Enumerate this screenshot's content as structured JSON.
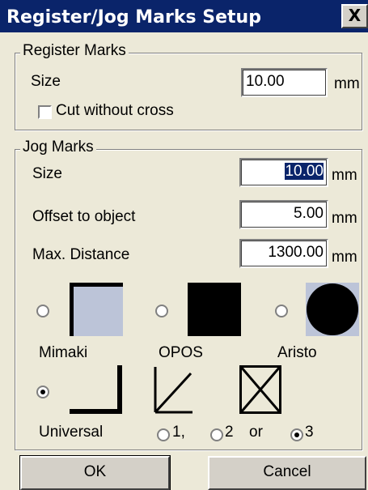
{
  "window": {
    "title": "Register/Jog Marks Setup",
    "close_label": "X"
  },
  "register_marks": {
    "legend": "Register Marks",
    "size_label": "Size",
    "size_value": "10.00",
    "size_unit": "mm",
    "cut_without_cross_label": "Cut without cross",
    "cut_without_cross_checked": false
  },
  "jog_marks": {
    "legend": "Jog  Marks",
    "size_label": "Size",
    "size_value": "10.00",
    "size_unit": "mm",
    "offset_label": "Offset to object",
    "offset_value": "5.00",
    "offset_unit": "mm",
    "max_distance_label": "Max. Distance",
    "max_distance_value": "1300.00",
    "max_distance_unit": "mm",
    "mark_types": [
      {
        "label": "Mimaki",
        "selected": false
      },
      {
        "label": "OPOS",
        "selected": false
      },
      {
        "label": "Aristo",
        "selected": false
      },
      {
        "label": "Universal",
        "selected": true
      }
    ],
    "universal_options": [
      {
        "label": "1,",
        "selected": false
      },
      {
        "label": "2",
        "selected": false
      },
      {
        "label": "3",
        "selected": true
      }
    ],
    "or_label": "or"
  },
  "buttons": {
    "ok": "OK",
    "cancel": "Cancel"
  },
  "colors": {
    "title_bar": "#0A246A",
    "dialog_bg": "#ECE9D8",
    "selection": "#0A246A"
  }
}
